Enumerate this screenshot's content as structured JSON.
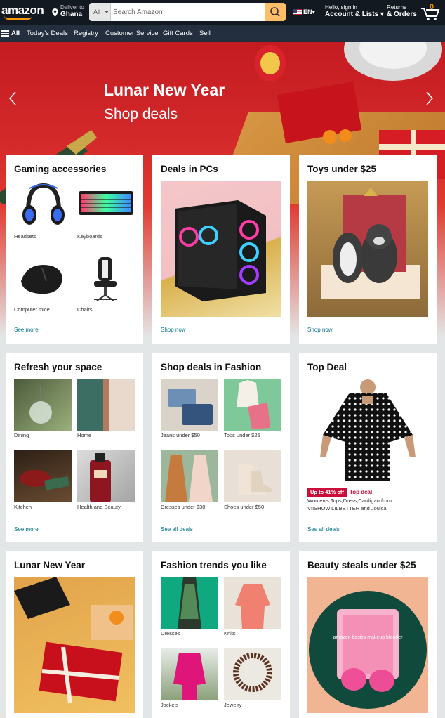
{
  "header": {
    "logo": "amazon",
    "deliver_line1": "Deliver to",
    "deliver_line2": "Ghana",
    "search_category": "All",
    "search_placeholder": "Search Amazon",
    "language": "EN",
    "account_line1": "Hello, sign in",
    "account_line2": "Account & Lists",
    "returns_line1": "Returns",
    "returns_line2": "& Orders",
    "cart_count": "0"
  },
  "subnav": {
    "all": "All",
    "items": [
      "Today's Deals",
      "Registry",
      "Customer Service",
      "Gift Cards",
      "Sell"
    ]
  },
  "hero": {
    "title": "Lunar New Year",
    "subtitle": "Shop deals"
  },
  "cards": {
    "gaming": {
      "title": "Gaming accessories",
      "items": [
        "Headsets",
        "Keyboards",
        "Computer mice",
        "Chairs"
      ],
      "link": "See more"
    },
    "pcs": {
      "title": "Deals in PCs",
      "link": "Shop now"
    },
    "toys": {
      "title": "Toys under $25",
      "link": "Shop now"
    },
    "refresh": {
      "title": "Refresh your space",
      "items": [
        "Dining",
        "Home",
        "Kitchen",
        "Health and Beauty"
      ],
      "link": "See more"
    },
    "fashion": {
      "title": "Shop deals in Fashion",
      "items": [
        "Jeans under $50",
        "Tops under $25",
        "Dresses under $30",
        "Shoes under $50"
      ],
      "link": "See all deals"
    },
    "topdeal": {
      "title": "Top Deal",
      "badge": "Up to 41% off",
      "deal_label": "Top deal",
      "description": "Women's Tops,Dress,Cardigan from VIISHOW,LILBETTER and Jouica",
      "link": "See all deals"
    },
    "lunar": {
      "title": "Lunar New Year"
    },
    "trends": {
      "title": "Fashion trends you like",
      "items": [
        "Dresses",
        "Knits",
        "Jackets",
        "Jewelry"
      ]
    },
    "beauty": {
      "title": "Beauty steals under $25",
      "product_text": "amazon basics makeup blender"
    }
  },
  "colors": {
    "nav_bg": "#131921",
    "subnav_bg": "#232f3e",
    "search_button": "#febd69",
    "link": "#007185",
    "deal_red": "#cc0c39"
  }
}
